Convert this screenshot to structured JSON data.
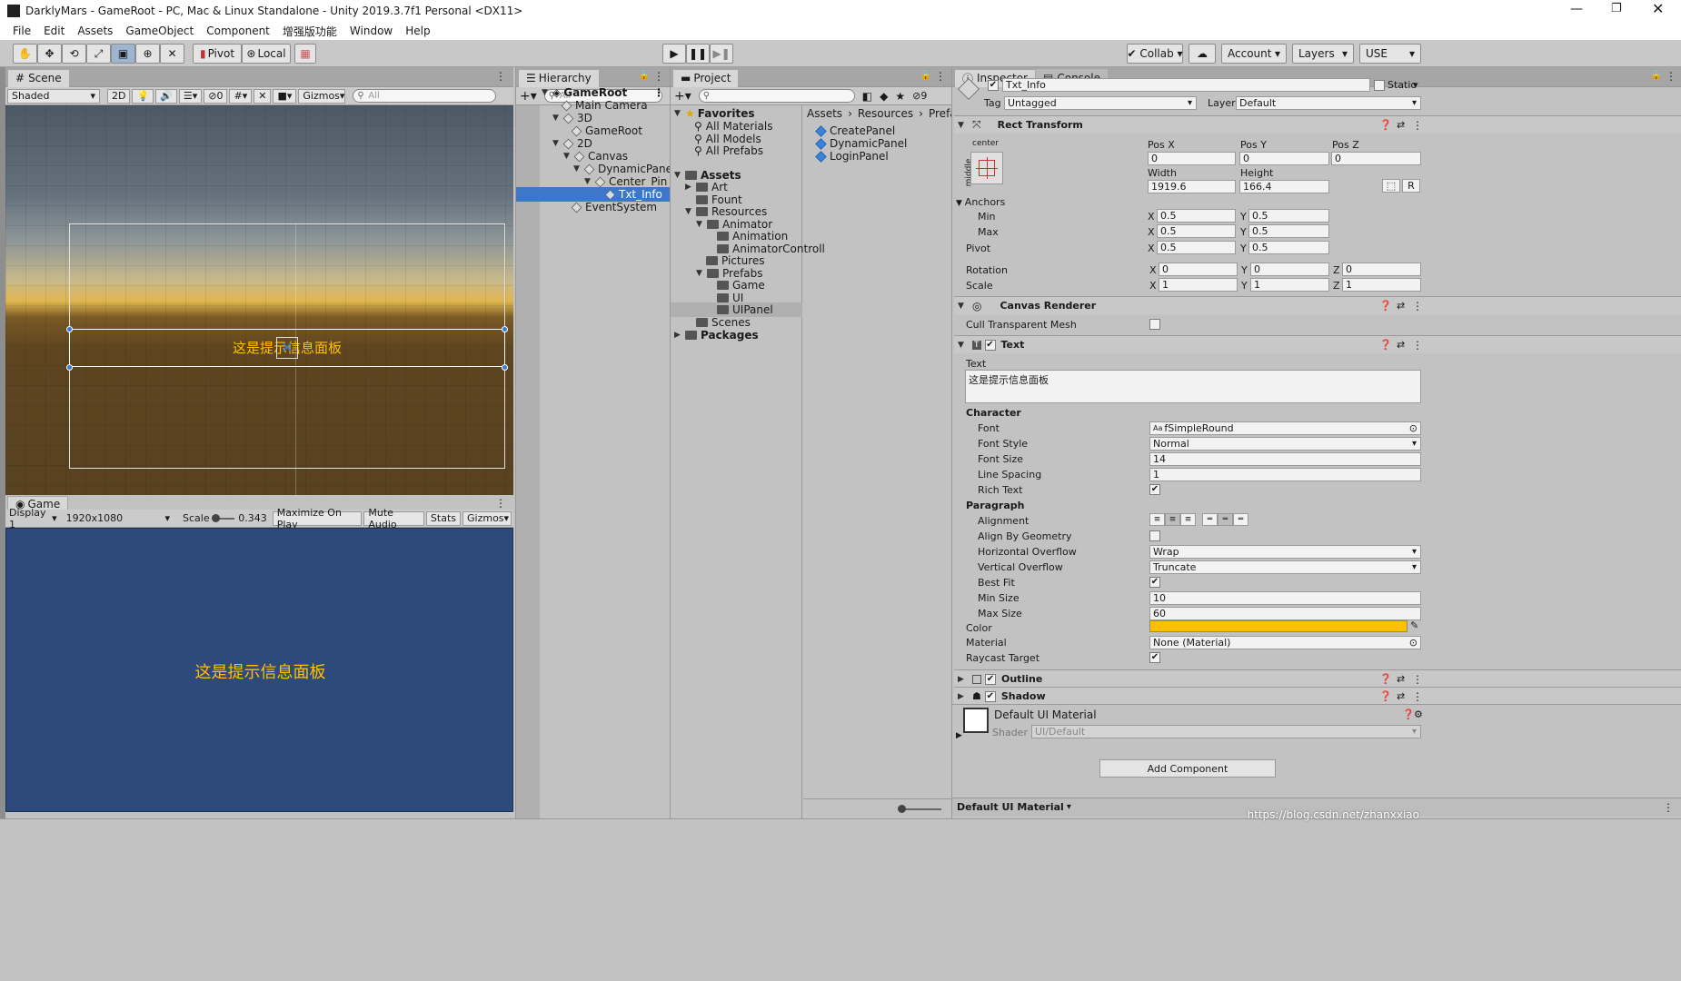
{
  "window_title": "DarklyMars - GameRoot - PC, Mac & Linux Standalone - Unity 2019.3.7f1 Personal <DX11>",
  "menu": [
    "File",
    "Edit",
    "Assets",
    "GameObject",
    "Component",
    "增强版功能",
    "Window",
    "Help"
  ],
  "toolbar": {
    "pivot": "Pivot",
    "local": "Local",
    "collab": "Collab",
    "account": "Account",
    "layers": "Layers",
    "layout": "USE"
  },
  "scene": {
    "tab": "Scene",
    "shading": "Shaded",
    "mode_2d": "2D",
    "hidden_count": "0",
    "gizmos": "Gizmos",
    "search_placeholder": "All",
    "panel_text": "这是提示信息面板"
  },
  "game": {
    "tab": "Game",
    "display": "Display 1",
    "resolution": "1920x1080",
    "scale_label": "Scale",
    "scale_value": "0.343",
    "maximize": "Maximize On Play",
    "mute": "Mute Audio",
    "stats": "Stats",
    "gizmos": "Gizmos",
    "panel_text": "这是提示信息面板"
  },
  "hierarchy": {
    "tab": "Hierarchy",
    "search_placeholder": "All",
    "items": [
      "GameRoot",
      "Main Camera",
      "3D",
      "GameRoot",
      "2D",
      "Canvas",
      "DynamicPanel",
      "Center_Pin",
      "Txt_Info",
      "EventSystem"
    ]
  },
  "project": {
    "tab": "Project",
    "hidden_count": "9",
    "favorites": "Favorites",
    "fav_items": [
      "All Materials",
      "All Models",
      "All Prefabs"
    ],
    "assets": "Assets",
    "tree": [
      "Art",
      "Fount",
      "Resources",
      "Animator",
      "Animation",
      "AnimatorControll",
      "Pictures",
      "Prefabs",
      "Game",
      "UI",
      "UIPanel",
      "Scenes"
    ],
    "packages": "Packages",
    "breadcrumb": [
      "Assets",
      "Resources",
      "Prefabs"
    ],
    "files": [
      "CreatePanel",
      "DynamicPanel",
      "LoginPanel"
    ]
  },
  "inspector": {
    "tab": "Inspector",
    "console_tab": "Console",
    "object_name": "Txt_Info",
    "static": "Static",
    "tag_label": "Tag",
    "tag": "Untagged",
    "layer_label": "Layer",
    "layer": "Default",
    "rect": {
      "title": "Rect Transform",
      "anchor_h": "center",
      "anchor_v": "middle",
      "posx_label": "Pos X",
      "posy_label": "Pos Y",
      "posz_label": "Pos Z",
      "posx": "0",
      "posy": "0",
      "posz": "0",
      "width_label": "Width",
      "height_label": "Height",
      "width": "1919.6",
      "height": "166.4",
      "anchors": "Anchors",
      "min": "Min",
      "max": "Max",
      "min_x": "0.5",
      "min_y": "0.5",
      "max_x": "0.5",
      "max_y": "0.5",
      "pivot": "Pivot",
      "pivot_x": "0.5",
      "pivot_y": "0.5",
      "rotation": "Rotation",
      "rot_x": "0",
      "rot_y": "0",
      "rot_z": "0",
      "scale": "Scale",
      "scale_x": "1",
      "scale_y": "1",
      "scale_z": "1",
      "x": "X",
      "y": "Y",
      "z": "Z",
      "r_button": "R"
    },
    "canvas_renderer": {
      "title": "Canvas Renderer",
      "cull": "Cull Transparent Mesh"
    },
    "text": {
      "title": "Text",
      "text_label": "Text",
      "text_value": "这是提示信息面板",
      "character": "Character",
      "font_label": "Font",
      "font": "fSimpleRound",
      "font_style_label": "Font Style",
      "font_style": "Normal",
      "font_size_label": "Font Size",
      "font_size": "14",
      "line_spacing_label": "Line Spacing",
      "line_spacing": "1",
      "rich_text_label": "Rich Text",
      "paragraph": "Paragraph",
      "alignment_label": "Alignment",
      "align_geom_label": "Align By Geometry",
      "h_overflow_label": "Horizontal Overflow",
      "h_overflow": "Wrap",
      "v_overflow_label": "Vertical Overflow",
      "v_overflow": "Truncate",
      "best_fit_label": "Best Fit",
      "min_size_label": "Min Size",
      "min_size": "10",
      "max_size_label": "Max Size",
      "max_size": "60",
      "color_label": "Color",
      "color": "#ffc000",
      "material_label": "Material",
      "material": "None (Material)",
      "raycast_label": "Raycast Target"
    },
    "outline": "Outline",
    "shadow": "Shadow",
    "material_name": "Default UI Material",
    "shader_label": "Shader",
    "shader": "UI/Default",
    "add_component": "Add Component",
    "footer_material": "Default UI Material"
  },
  "watermark": "https://blog.csdn.net/zhanxxiao"
}
